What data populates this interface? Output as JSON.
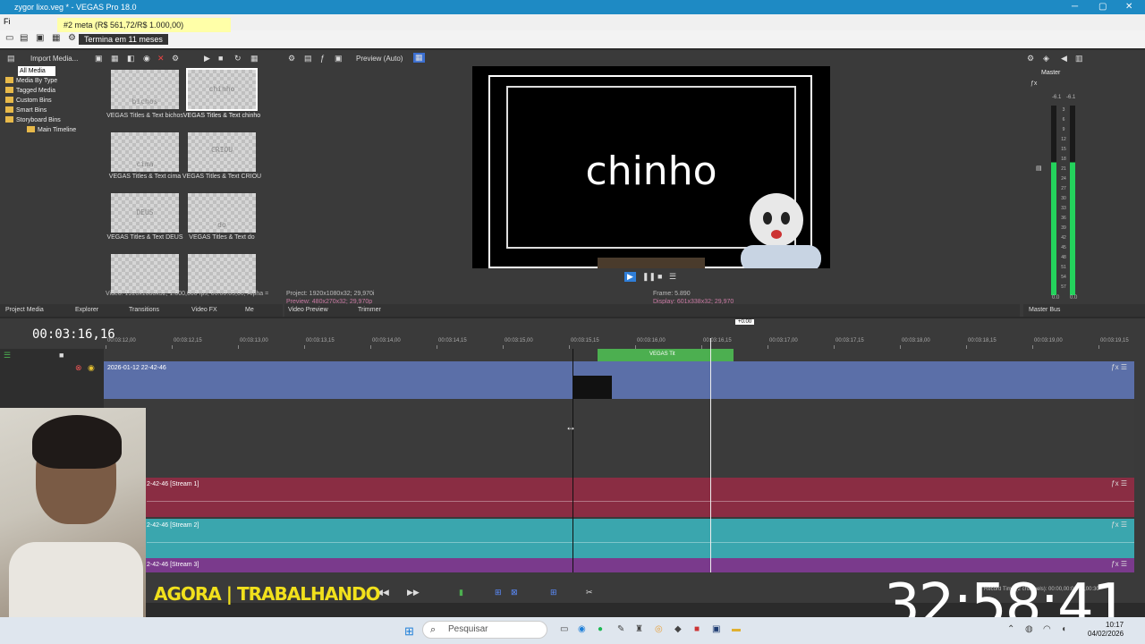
{
  "window": {
    "title": "zygor lixo.veg * - VEGAS Pro 18.0",
    "menu_fragment": "Fi"
  },
  "meta_tooltip": {
    "goal": "#2 meta (R$ 561,72/R$ 1.000,00)",
    "subtitle": "Termina em 11 meses"
  },
  "media": {
    "import_label": "Import Media...",
    "tree": [
      "All Media",
      "Media By Type",
      "Tagged Media",
      "Custom Bins",
      "Smart Bins",
      "Storyboard Bins",
      "Main Timeline"
    ],
    "items": [
      {
        "thumb": "bichos",
        "caption": "VEGAS Titles & Text bichos"
      },
      {
        "thumb": "chinho",
        "caption": "VEGAS Titles & Text chinho"
      },
      {
        "thumb": "cima",
        "caption": "VEGAS Titles & Text cima"
      },
      {
        "thumb": "CRIOU",
        "caption": "VEGAS Titles & Text CRIOU"
      },
      {
        "thumb": "DEUS",
        "caption": "VEGAS Titles & Text DEUS"
      },
      {
        "thumb": "do",
        "caption": "VEGAS Titles & Text do"
      },
      {
        "thumb": "",
        "caption": ""
      },
      {
        "thumb": "",
        "caption": ""
      }
    ],
    "status": "Video: 1920x1080x32; 1.000,000 fps; 00:00:05,00; Alpha ="
  },
  "left_tabs": [
    "Project Media",
    "Explorer",
    "Transitions",
    "Video FX",
    "Me"
  ],
  "preview": {
    "mode": "Preview (Auto)",
    "overlay_text": "chinho",
    "project": "Project:  1920x1080x32; 29,970i",
    "preview": "Preview:  480x270x32; 29,970p",
    "frame": "Frame:  5.890",
    "display": "Display:  601x338x32; 29,970",
    "tabs": [
      "Video Preview",
      "Trimmer"
    ]
  },
  "master": {
    "title": "Master",
    "tab": "Master Bus",
    "db_top": [
      "-6.1",
      "-6.1"
    ],
    "scale": [
      "3",
      "6",
      "9",
      "12",
      "15",
      "18",
      "21",
      "24",
      "27",
      "30",
      "33",
      "36",
      "39",
      "42",
      "45",
      "48",
      "51",
      "54",
      "57"
    ],
    "bottom": [
      "0.0",
      "0.0"
    ]
  },
  "timeline": {
    "timecode": "00:03:16,16",
    "marker": "+0.00",
    "ruler": [
      "00:03:12,00",
      "00:03:12,15",
      "00:03:13,00",
      "00:03:13,15",
      "00:03:14,00",
      "00:03:14,15",
      "00:03:15,00",
      "00:03:15,15",
      "00:03:16,00",
      "00:03:16,15",
      "00:03:17,00",
      "00:03:17,15",
      "00:03:18,00",
      "00:03:18,15",
      "00:03:19,00",
      "00:03:19,15"
    ],
    "video_clip": "2026-01-12 22-42-46",
    "title_clip": "VEGAS Tit",
    "audio": [
      "2-42-46 [Stream 1]",
      "2-42-46 [Stream 2]",
      "2-42-46 [Stream 3]"
    ]
  },
  "overlay": {
    "banner": "AGORA | TRABALHANDO",
    "big_clock": "32:58:41"
  },
  "status_bar": {
    "record_time": "Record Time (2 channels): 00:00,00:00:00,00:30"
  },
  "taskbar": {
    "search_placeholder": "Pesquisar",
    "time": "10:17",
    "date": "04/02/2026"
  }
}
